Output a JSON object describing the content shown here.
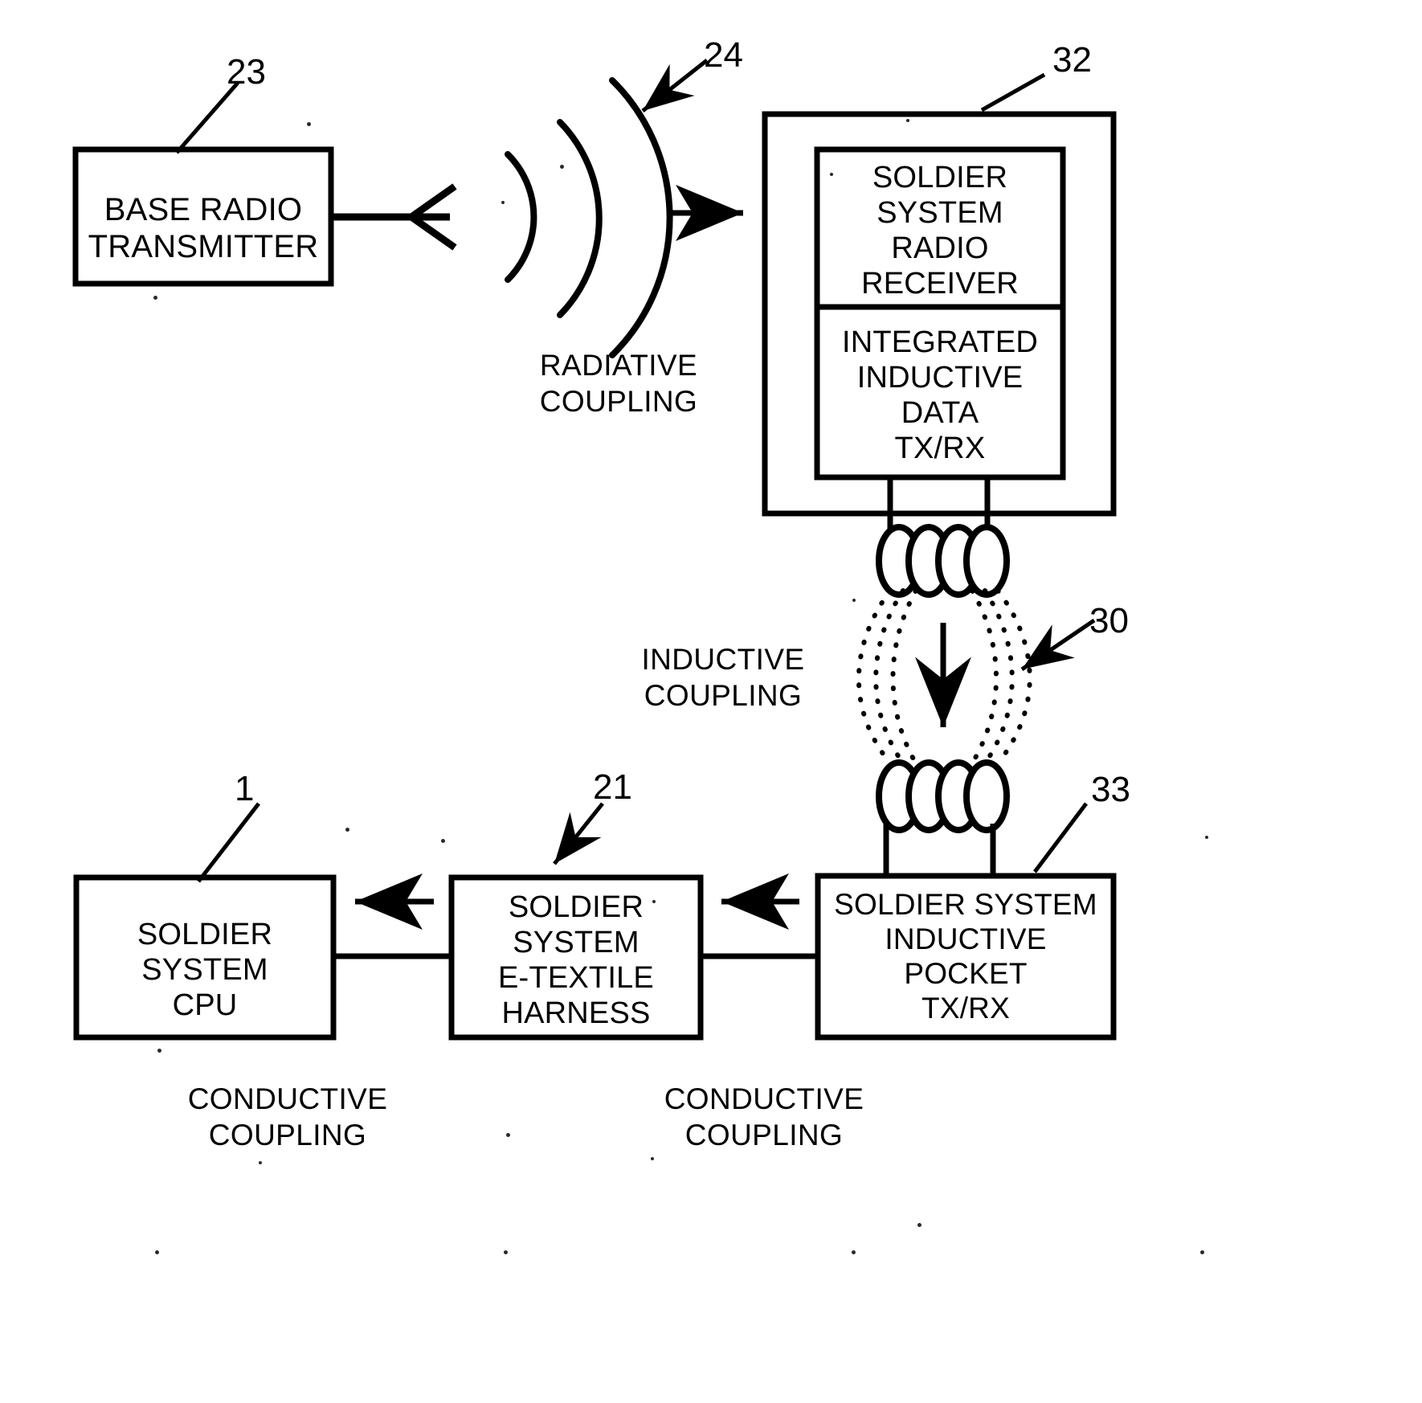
{
  "figure": {
    "kind": "patent-block-diagram",
    "background_color": "#ffffff",
    "ink_color": "#000000"
  },
  "boxes": {
    "base_radio_transmitter": {
      "label": "BASE RADIO\nTRANSMITTER",
      "ref": "23"
    },
    "soldier_system_radio_receiver": {
      "label": "SOLDIER\nSYSTEM\nRADIO\nRECEIVER"
    },
    "integrated_inductive_data_txrx": {
      "label": "INTEGRATED\nINDUCTIVE\nDATA\nTX/RX"
    },
    "outer_unit": {
      "ref": "32"
    },
    "soldier_system_cpu": {
      "label": "SOLDIER\nSYSTEM\nCPU",
      "ref": "1"
    },
    "soldier_system_etextile_harness": {
      "label": "SOLDIER\nSYSTEM\nE-TEXTILE\nHARNESS",
      "ref": "21"
    },
    "soldier_system_inductive_pocket_txrx": {
      "label": "SOLDIER SYSTEM\nINDUCTIVE\nPOCKET\nTX/RX",
      "ref": "33"
    }
  },
  "captions": {
    "radiative_coupling": "RADIATIVE\nCOUPLING",
    "inductive_coupling": "INDUCTIVE\nCOUPLING",
    "conductive_coupling_left": "CONDUCTIVE\nCOUPLING",
    "conductive_coupling_right": "CONDUCTIVE\nCOUPLING"
  },
  "ref_numerals": {
    "radiative_wave": "24",
    "inductive_field": "30",
    "base_transmitter": "23",
    "receiver_unit": "32",
    "cpu": "1",
    "harness": "21",
    "pocket": "33"
  }
}
